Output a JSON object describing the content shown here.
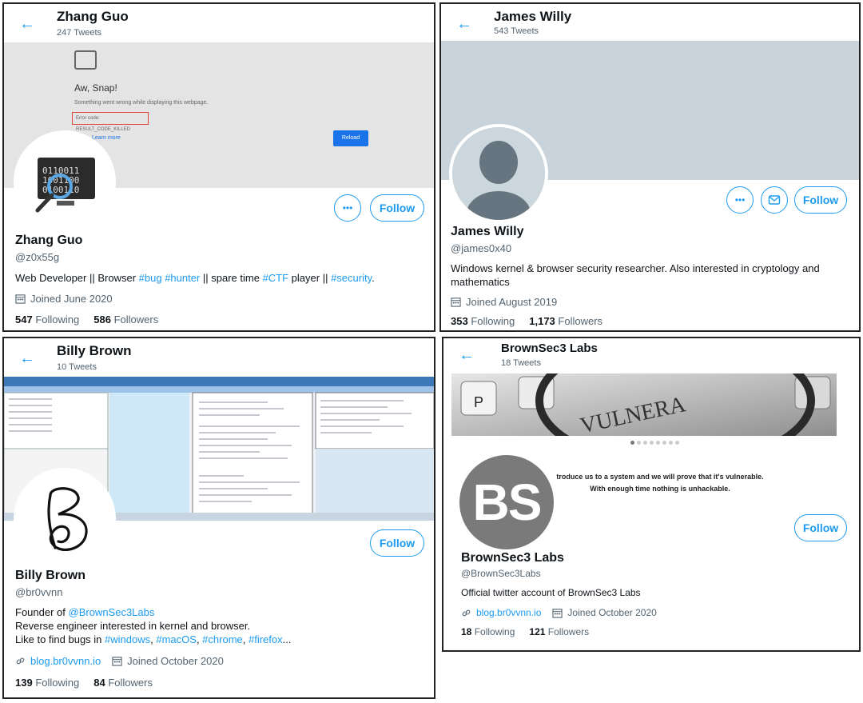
{
  "profiles": [
    {
      "header_name": "Zhang Guo",
      "tweet_count": "247 Tweets",
      "banner": {
        "title": "Aw, Snap!",
        "subtitle": "Something went wrong while displaying this webpage.",
        "error_code": "Error code: RESULT_CODE_KILLED",
        "learn_more": "Learn more",
        "reload": "Reload"
      },
      "name": "Zhang Guo",
      "handle": "@z0x55g",
      "bio_parts": [
        "Web Developer || Browser ",
        "#bug",
        " ",
        "#hunter",
        " || spare time ",
        "#CTF",
        " player || ",
        "#security",
        "."
      ],
      "joined": "Joined June 2020",
      "following_count": "547",
      "following_label": "Following",
      "followers_count": "586",
      "followers_label": "Followers",
      "follow_label": "Follow"
    },
    {
      "header_name": "James Willy",
      "tweet_count": "543 Tweets",
      "name": "James Willy",
      "handle": "@james0x40",
      "bio": "Windows kernel & browser security researcher. Also interested in cryptology and mathematics",
      "joined": "Joined August 2019",
      "following_count": "353",
      "following_label": "Following",
      "followers_count": "1,173",
      "followers_label": "Followers",
      "follow_label": "Follow"
    },
    {
      "header_name": "Billy Brown",
      "tweet_count": "10 Tweets",
      "name": "Billy Brown",
      "handle": "@br0vvnn",
      "bio_line1_prefix": "Founder of ",
      "bio_line1_mention": "@BrownSec3Labs",
      "bio_line2": "Reverse engineer interested in kernel and browser.",
      "bio_line3_parts": [
        "Like to find bugs in ",
        "#windows",
        ", ",
        "#macOS",
        ", ",
        "#chrome",
        ", ",
        "#firefox",
        "..."
      ],
      "website": "blog.br0vvnn.io",
      "joined": "Joined October 2020",
      "following_count": "139",
      "following_label": "Following",
      "followers_count": "84",
      "followers_label": "Followers",
      "follow_label": "Follow"
    },
    {
      "header_name": "BrownSec3 Labs",
      "tweet_count": "18 Tweets",
      "banner_text": "VULNERA",
      "quote_line1": "troduce us to a system and we will prove that it's vulnerable.",
      "quote_line2": "With enough time nothing is unhackable.",
      "avatar_text": "BS",
      "name": "BrownSec3 Labs",
      "handle": "@BrownSec3Labs",
      "bio": "Official twitter account of BrownSec3 Labs",
      "website": "blog.br0vvnn.io",
      "joined": "Joined October 2020",
      "following_count": "18",
      "following_label": "Following",
      "followers_count": "121",
      "followers_label": "Followers",
      "follow_label": "Follow"
    }
  ],
  "colors": {
    "accent": "#1d9bf0",
    "muted": "#536471",
    "banner_gray": "#c8d3db"
  }
}
